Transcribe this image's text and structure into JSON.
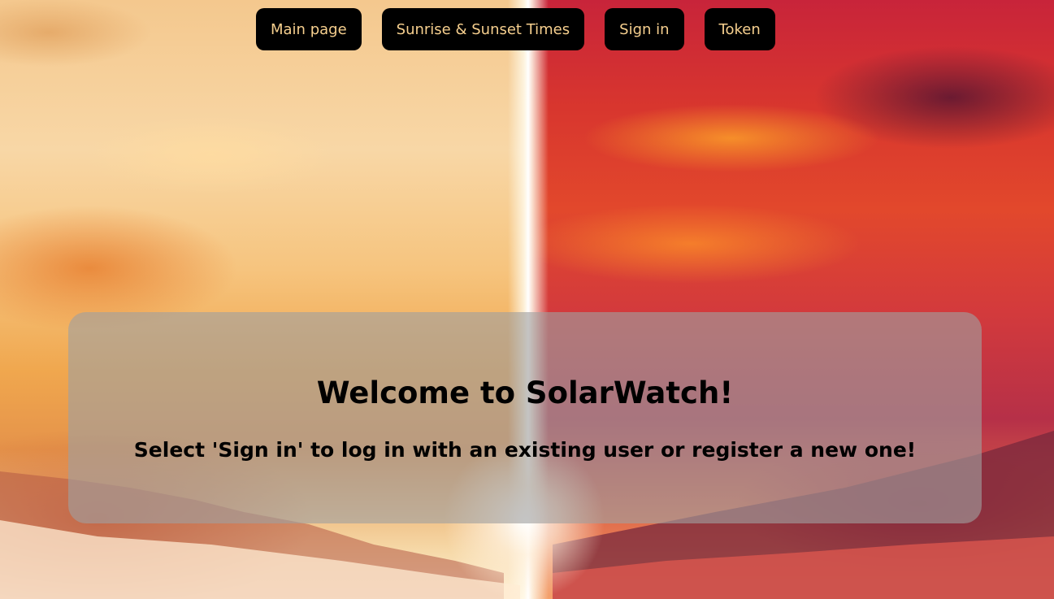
{
  "nav": {
    "items": [
      {
        "label": "Main page"
      },
      {
        "label": "Sunrise & Sunset Times"
      },
      {
        "label": "Sign in"
      },
      {
        "label": "Token"
      }
    ]
  },
  "welcome": {
    "title": "Welcome to SolarWatch!",
    "subtitle": "Select 'Sign in' to log in with an existing user or register a new one!"
  },
  "colors": {
    "nav_background": "#000000",
    "nav_text": "#f6cf8e",
    "panel_background": "rgba(160,160,160,0.62)"
  }
}
